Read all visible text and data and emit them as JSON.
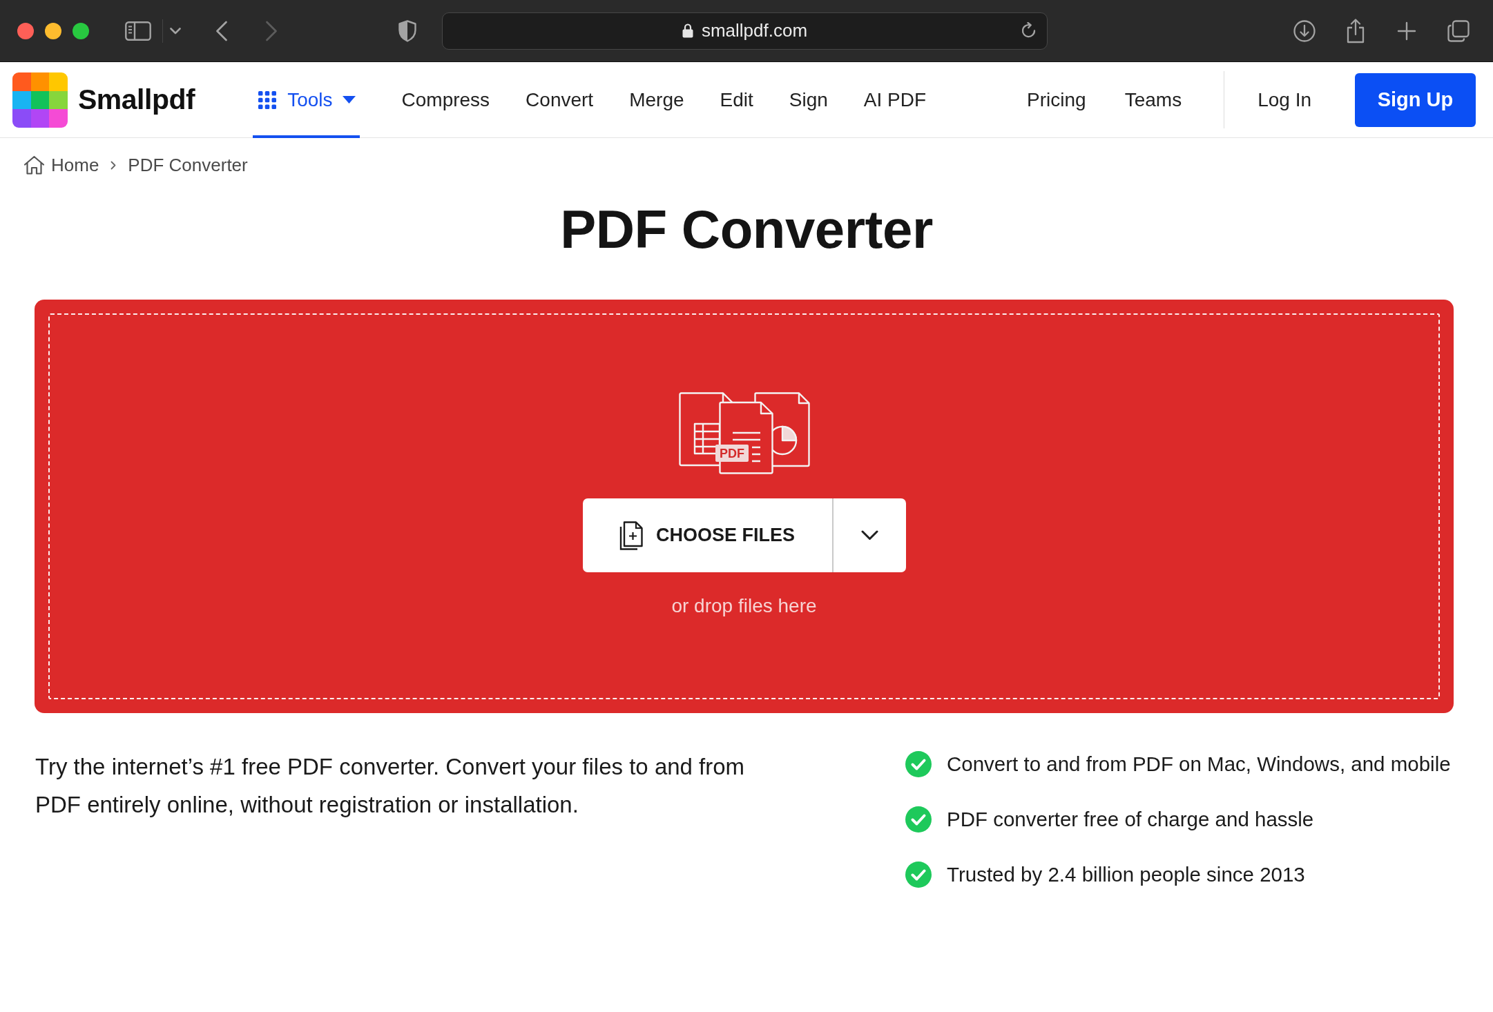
{
  "browser": {
    "url": "smallpdf.com"
  },
  "nav": {
    "brand": "Smallpdf",
    "items": [
      {
        "label": "Tools",
        "kind": "menu",
        "selected": true
      },
      {
        "label": "Compress",
        "kind": "link",
        "selected": false
      },
      {
        "label": "Convert",
        "kind": "link",
        "selected": false
      },
      {
        "label": "Merge",
        "kind": "link",
        "selected": false
      },
      {
        "label": "Edit",
        "kind": "link",
        "selected": false
      },
      {
        "label": "Sign",
        "kind": "link",
        "selected": false
      },
      {
        "label": "AI PDF",
        "kind": "link",
        "selected": false
      }
    ],
    "secondary_items": [
      {
        "label": "Pricing",
        "selected": false
      },
      {
        "label": "Teams",
        "selected": false
      }
    ],
    "login": "Log In",
    "signup": "Sign Up"
  },
  "breadcrumb": [
    {
      "label": "Home",
      "kind": "home"
    },
    {
      "label": "PDF Converter",
      "kind": "current"
    }
  ],
  "title": "PDF Converter",
  "dropzone": {
    "illustration_label": "PDF",
    "button": "CHOOSE FILES",
    "hint": "or drop files here"
  },
  "intro": "Try the internet’s #1 free PDF converter. Convert your files to and from PDF entirely online, without registration or installation.",
  "features": [
    "Convert to and from PDF on Mac, Windows, and mobile",
    "PDF converter free of charge and hassle",
    "Trusted by 2.4 billion people since 2013"
  ]
}
